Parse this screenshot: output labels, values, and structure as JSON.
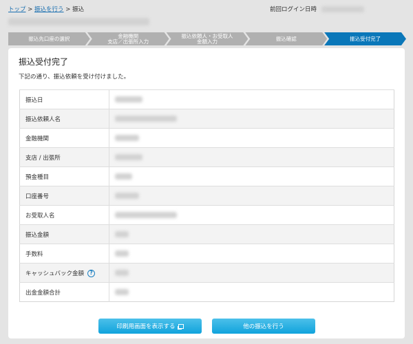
{
  "breadcrumb": [
    {
      "label": "トップ",
      "link": true
    },
    {
      "label": "振込を行う",
      "link": true
    },
    {
      "label": "振込",
      "link": false
    }
  ],
  "breadcrumb_separator": ">",
  "last_login_label": "前回ログイン日時",
  "steps": [
    {
      "label": "振込先口座の選択",
      "active": false
    },
    {
      "label": "金融機関\n支店／出張所入力",
      "active": false
    },
    {
      "label": "振込依頼人・お受取人\n金額入力",
      "active": false
    },
    {
      "label": "振込確認",
      "active": false
    },
    {
      "label": "振込受付完了",
      "active": true
    }
  ],
  "title": "振込受付完了",
  "description": "下記の通り、振込依頼を受け付けました。",
  "rows": [
    {
      "label": "振込日"
    },
    {
      "label": "振込依頼人名"
    },
    {
      "label": "金融機関"
    },
    {
      "label": "支店 / 出張所"
    },
    {
      "label": "預金種目"
    },
    {
      "label": "口座番号"
    },
    {
      "label": "お受取人名"
    },
    {
      "label": "振込金額"
    },
    {
      "label": "手数料"
    },
    {
      "label": "キャッシュバック金額",
      "help": "?"
    },
    {
      "label": "出金金額合計"
    }
  ],
  "buttons": {
    "print": "印刷用画面を表示する",
    "other": "他の振込を行う"
  },
  "colors": {
    "accent": "#0a77b9",
    "button": "#10a3dc",
    "link": "#1a6fb0"
  }
}
